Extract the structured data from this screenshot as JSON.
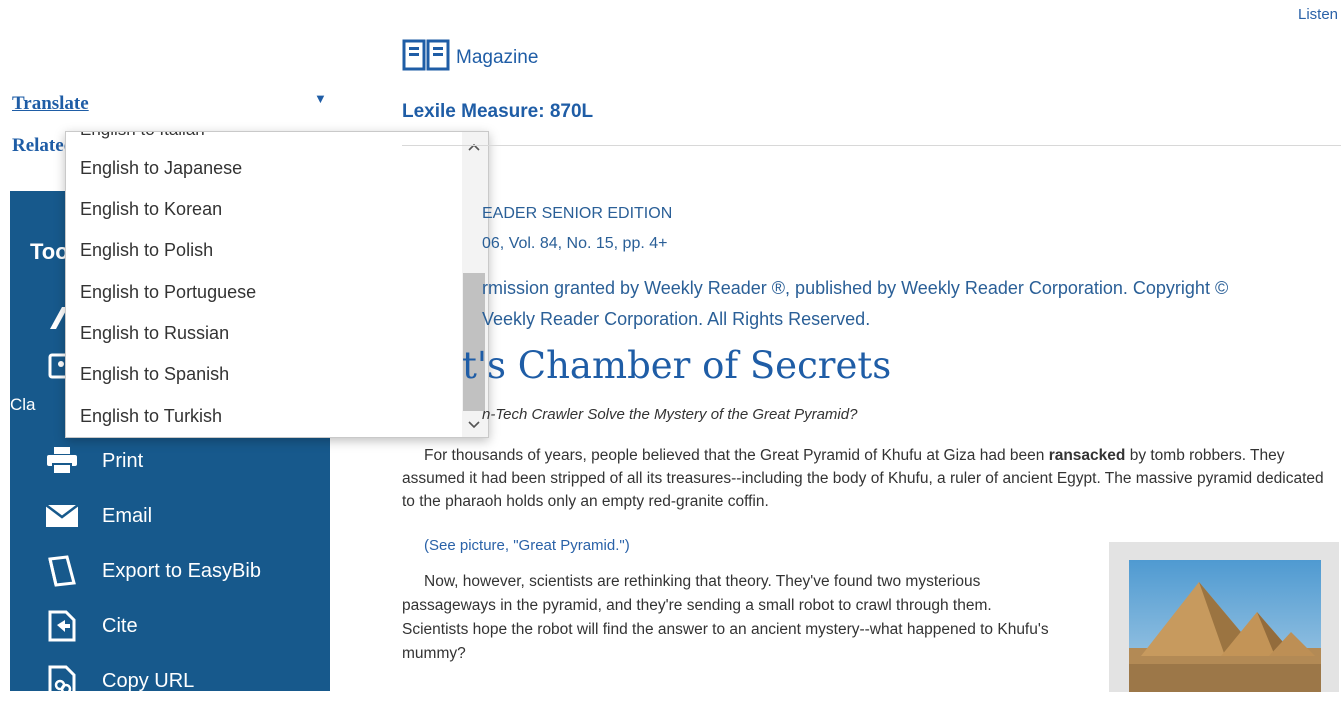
{
  "header": {
    "listen_label": "Listen"
  },
  "sidebar": {
    "translate_label": "Translate",
    "related_label": "Related Subjects",
    "tools_title": "Tools",
    "class_fragment": "Cla",
    "tools": [
      {
        "label": "Print",
        "icon": "printer-icon"
      },
      {
        "label": "Email",
        "icon": "envelope-icon"
      },
      {
        "label": "Export to EasyBib",
        "icon": "easybib-icon"
      },
      {
        "label": "Cite",
        "icon": "cite-icon"
      },
      {
        "label": "Copy URL",
        "icon": "link-icon"
      }
    ]
  },
  "translate_dropdown": {
    "partial_top_item": "English to Italian",
    "options": [
      "English to Japanese",
      "English to Korean",
      "English to Polish",
      "English to Portuguese",
      "English to Russian",
      "English to Spanish",
      "English to Turkish"
    ]
  },
  "article": {
    "source_type": "Magazine",
    "lexile": "Lexile Measure: 870L",
    "source_title": "EADER SENIOR EDITION",
    "source_citation": "06, Vol. 84, No. 15, pp. 4+",
    "permission_line1": "rmission granted by Weekly Reader ®, published by Weekly Reader Corporation. Copyright ©",
    "permission_line2": "Veekly Reader Corporation. All Rights Reserved.",
    "headline": "t's Chamber of Secrets",
    "subtitle": "n-Tech Crawler Solve the Mystery of the Great Pyramid?",
    "para1_before": "For thousands of years, people believed that the Great Pyramid of Khufu at Giza had been ",
    "para1_bold": "ransacked",
    "para1_after": " by tomb robbers. They assumed it had been stripped of all its treasures--including the body of Khufu, a ruler of ancient Egypt. The massive pyramid dedicated to the pharaoh holds only an empty red-granite coffin.",
    "picture_link": "(See picture, \"Great Pyramid.\")",
    "para2": "Now, however, scientists are rethinking that theory. They've found two mysterious passageways in the pyramid, and they're sending a small robot to crawl through them. Scientists hope the robot will find the answer to an ancient mystery--what happened to Khufu's mummy?"
  },
  "colors": {
    "brand_blue": "#1f5da6",
    "panel_blue": "#17598c"
  }
}
